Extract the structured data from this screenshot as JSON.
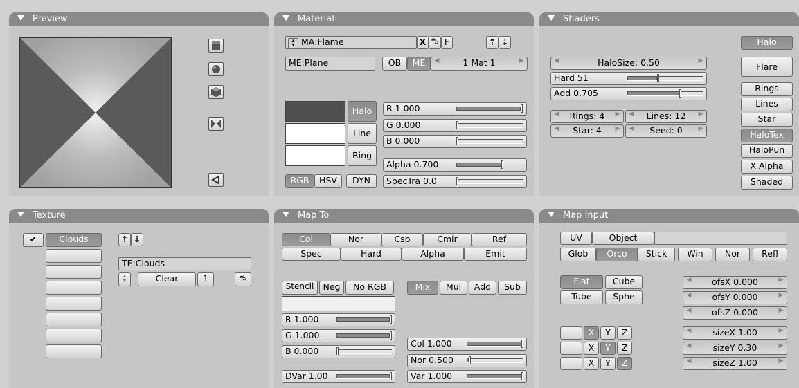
{
  "preview": {
    "title": "Preview"
  },
  "material": {
    "title": "Material",
    "ma_name": "MA:Flame",
    "x_label": "X",
    "f_label": "F",
    "me_name": "ME:Plane",
    "ob_label": "OB",
    "me_label": "ME",
    "mat_label": "1 Mat 1",
    "halo_label": "Halo",
    "line_label": "Line",
    "ring_label": "Ring",
    "r": "R 1.000",
    "g": "G 0.000",
    "b": "B 0.000",
    "alpha": "Alpha 0.700",
    "spectra": "SpecTra 0.0",
    "rgb": "RGB",
    "hsv": "HSV",
    "dyn": "DYN",
    "r_value": 1.0,
    "g_value": 0.0,
    "b_value": 0.0,
    "alpha_value": 0.7,
    "spectra_value": 0.0,
    "swatch_colors": [
      "#505050",
      "#ffffff",
      "#ffffff"
    ]
  },
  "shaders": {
    "title": "Shaders",
    "halo": "Halo",
    "halosize": "HaloSize: 0.50",
    "hard": "Hard 51",
    "add": "Add  0.705",
    "hard_value": 0.4,
    "add_value": 0.705,
    "rings": "Rings: 4",
    "lines": "Lines: 12",
    "star": "Star: 4",
    "seed": "Seed: 0",
    "flare": "Flare",
    "rings_btn": "Rings",
    "lines_btn": "Lines",
    "star_btn": "Star",
    "halotex": "HaloTex",
    "halopun": "HaloPun",
    "xalpha": "X Alpha",
    "shaded": "Shaded"
  },
  "texture": {
    "title": "Texture",
    "check": "✔",
    "slot1": "Clouds",
    "te_name": "TE:Clouds",
    "clear": "Clear",
    "users": "1"
  },
  "mapto": {
    "title": "Map To",
    "col": "Col",
    "nor": "Nor",
    "csp": "Csp",
    "cmir": "Cmir",
    "ref": "Ref",
    "spec": "Spec",
    "hard": "Hard",
    "alpha": "Alpha",
    "emit": "Emit",
    "stencil": "Stencil",
    "neg": "Neg",
    "norgb": "No RGB",
    "mix": "Mix",
    "mul": "Mul",
    "addb": "Add",
    "sub": "Sub",
    "r": "R 1.000",
    "g": "G 1.000",
    "b": "B 0.000",
    "r_value": 1.0,
    "g_value": 1.0,
    "b_value": 0.0,
    "colf": "Col 1.000",
    "norf": "Nor 0.500",
    "var": "Var 1.000",
    "colf_value": 1.0,
    "norf_value": 0.04,
    "var_value": 1.0,
    "dvar": "DVar 1.00",
    "dvar_value": 1.0
  },
  "mapinput": {
    "title": "Map Input",
    "uv": "UV",
    "object": "Object",
    "glob": "Glob",
    "orco": "Orco",
    "stick": "Stick",
    "win": "Win",
    "nor": "Nor",
    "refl": "Refl",
    "flat": "Flat",
    "cube": "Cube",
    "tube": "Tube",
    "sphe": "Sphe",
    "ofsx": "ofsX 0.000",
    "ofsy": "ofsY 0.000",
    "ofsz": "ofsZ 0.000",
    "sizex": "sizeX 1.00",
    "sizey": "sizeY 0.30",
    "sizez": "sizeZ 1.00",
    "x": "X",
    "y": "Y",
    "z": "Z"
  }
}
